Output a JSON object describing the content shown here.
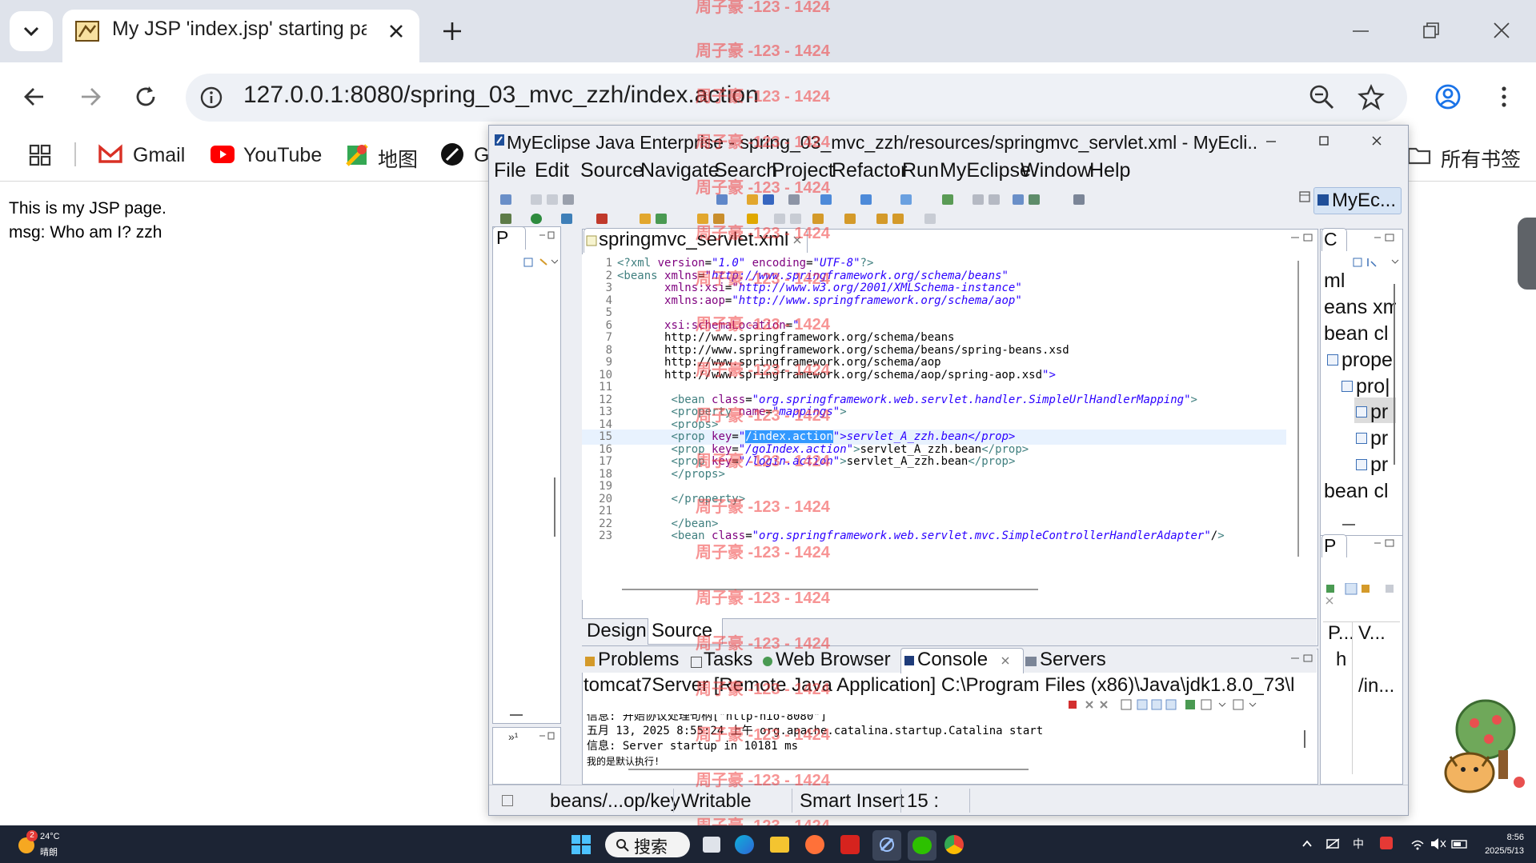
{
  "browser": {
    "tab_title": "My JSP 'index.jsp' starting pa",
    "url": "127.0.0.1:8080/spring_03_mvc_zzh/index.action",
    "bookmarks": [
      "Gmail",
      "YouTube",
      "地图",
      "G"
    ],
    "all_bookmarks": "所有书签"
  },
  "page": {
    "line1": "This is my JSP page.",
    "line2": "msg: Who am I? zzh"
  },
  "eclipse": {
    "title": "MyEclipse Java Enterprise - spring_03_mvc_zzh/resources/springmvc_servlet.xml - MyEcli...",
    "menu": [
      "File",
      "Edit",
      "Source",
      "Navigate",
      "Search",
      "Project",
      "Refactor",
      "Run",
      "MyEclipse",
      "Window",
      "Help"
    ],
    "perspective": "MyEc...",
    "left_panel_tab": "P",
    "editor_tab": "springmvc_servlet.xml",
    "editor_bottom_tabs": [
      "Design",
      "Source"
    ],
    "code_lines": [
      {
        "n": "1",
        "s": "<?xml version=\"1.0\" encoding=\"UTF-8\"?>"
      },
      {
        "n": "2",
        "s": "<beans xmlns=\"http://www.springframework.org/schema/beans\""
      },
      {
        "n": "3",
        "s": "       xmlns:xsi=\"http://www.w3.org/2001/XMLSchema-instance\""
      },
      {
        "n": "4",
        "s": "       xmlns:aop=\"http://www.springframework.org/schema/aop\""
      },
      {
        "n": "5",
        "s": ""
      },
      {
        "n": "6",
        "s": "       xsi:schemaLocation=\""
      },
      {
        "n": "7",
        "s": "       http://www.springframework.org/schema/beans"
      },
      {
        "n": "8",
        "s": "       http://www.springframework.org/schema/beans/spring-beans.xsd"
      },
      {
        "n": "9",
        "s": "       http://www.springframework.org/schema/aop"
      },
      {
        "n": "10",
        "s": "       http://www.springframework.org/schema/aop/spring-aop.xsd\">"
      },
      {
        "n": "11",
        "s": ""
      },
      {
        "n": "12",
        "s": "        <bean class=\"org.springframework.web.servlet.handler.SimpleUrlHandlerMapping\">"
      },
      {
        "n": "13",
        "s": "        <property name=\"mappings\">"
      },
      {
        "n": "14",
        "s": "        <props>"
      },
      {
        "n": "15",
        "s": "        <prop key=\"/index.action\">servlet_A_zzh.bean</prop>"
      },
      {
        "n": "16",
        "s": "        <prop key=\"/goIndex.action\">servlet_A_zzh.bean</prop>"
      },
      {
        "n": "17",
        "s": "        <prop key=\"/login.action\">servlet_A_zzh.bean</prop>"
      },
      {
        "n": "18",
        "s": "        </props>"
      },
      {
        "n": "19",
        "s": ""
      },
      {
        "n": "20",
        "s": "        </property>"
      },
      {
        "n": "21",
        "s": ""
      },
      {
        "n": "22",
        "s": "        </bean>"
      },
      {
        "n": "23",
        "s": "        <bean class=\"org.springframework.web.servlet.mvc.SimpleControllerHandlerAdapter\"/>"
      }
    ],
    "outline_tab": "C",
    "outline_items": [
      "ml",
      "eans xm",
      "bean cl",
      "prope",
      "pro|",
      "pr",
      "pr",
      "pr",
      "bean cl"
    ],
    "bottom_tabs": [
      "Problems",
      "Tasks",
      "Web Browser",
      "Console",
      "Servers"
    ],
    "console_title": "tomcat7Server [Remote Java Application] C:\\Program Files (x86)\\Java\\jdk1.8.0_73\\l",
    "console_lines": [
      "信息: 开始协议处理句柄[\"http-nio-8080\"]",
      "五月 13, 2025 8:55:24 上午 org.apache.catalina.startup.Catalina start",
      "信息: Server startup in 10181 ms",
      "我的是默认执行!"
    ],
    "right_bottom_tab": "P",
    "right_bottom_items": [
      "P...",
      "V...",
      "h",
      "/in..."
    ],
    "status": {
      "path": "beans/...op/key",
      "writable": "Writable",
      "insert": "Smart Insert",
      "position": "15 :"
    }
  },
  "watermark": "周子豪 -123 - 1424",
  "taskbar": {
    "weather_temp": "24°C",
    "weather_desc": "晴朗",
    "weather_badge": "2",
    "search": "搜索",
    "ime": "中",
    "time": "8:56",
    "date": "2025/5/13"
  },
  "colors": {
    "chrome_tabstrip": "#dfe3eb",
    "omnibox": "#eef1f6",
    "eclipse_frame": "#eceef3",
    "xml_tag": "#3f7f7f",
    "xml_attr": "#7f007f",
    "xml_string": "#2a00ff",
    "watermark": "#f03c3c",
    "taskbar": "#1c2434"
  }
}
